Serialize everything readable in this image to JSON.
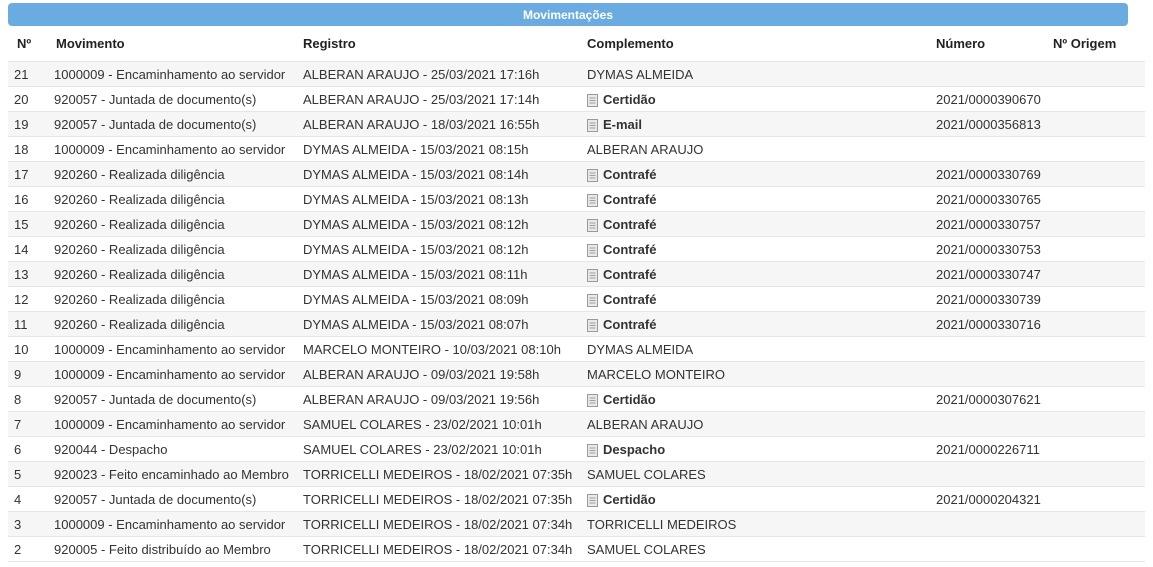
{
  "header": {
    "title": "Movimentações"
  },
  "columns": [
    "Nº",
    "Movimento",
    "Registro",
    "Complemento",
    "Número",
    "Nº Origem"
  ],
  "rows": [
    {
      "n": "21",
      "movimento": "1000009 - Encaminhamento ao servidor",
      "registro": "ALBERAN ARAUJO - 25/03/2021 17:16h",
      "complemento": "DYMAS ALMEIDA",
      "doc": false,
      "numero": "",
      "origem": ""
    },
    {
      "n": "20",
      "movimento": "920057 - Juntada de documento(s)",
      "registro": "ALBERAN ARAUJO - 25/03/2021 17:14h",
      "complemento": "Certidão",
      "doc": true,
      "numero": "2021/0000390670",
      "origem": ""
    },
    {
      "n": "19",
      "movimento": "920057 - Juntada de documento(s)",
      "registro": "ALBERAN ARAUJO - 18/03/2021 16:55h",
      "complemento": "E-mail",
      "doc": true,
      "numero": "2021/0000356813",
      "origem": ""
    },
    {
      "n": "18",
      "movimento": "1000009 - Encaminhamento ao servidor",
      "registro": "DYMAS ALMEIDA - 15/03/2021 08:15h",
      "complemento": "ALBERAN ARAUJO",
      "doc": false,
      "numero": "",
      "origem": ""
    },
    {
      "n": "17",
      "movimento": "920260 - Realizada diligência",
      "registro": "DYMAS ALMEIDA - 15/03/2021 08:14h",
      "complemento": "Contrafé",
      "doc": true,
      "numero": "2021/0000330769",
      "origem": ""
    },
    {
      "n": "16",
      "movimento": "920260 - Realizada diligência",
      "registro": "DYMAS ALMEIDA - 15/03/2021 08:13h",
      "complemento": "Contrafé",
      "doc": true,
      "numero": "2021/0000330765",
      "origem": ""
    },
    {
      "n": "15",
      "movimento": "920260 - Realizada diligência",
      "registro": "DYMAS ALMEIDA - 15/03/2021 08:12h",
      "complemento": "Contrafé",
      "doc": true,
      "numero": "2021/0000330757",
      "origem": ""
    },
    {
      "n": "14",
      "movimento": "920260 - Realizada diligência",
      "registro": "DYMAS ALMEIDA - 15/03/2021 08:12h",
      "complemento": "Contrafé",
      "doc": true,
      "numero": "2021/0000330753",
      "origem": ""
    },
    {
      "n": "13",
      "movimento": "920260 - Realizada diligência",
      "registro": "DYMAS ALMEIDA - 15/03/2021 08:11h",
      "complemento": "Contrafé",
      "doc": true,
      "numero": "2021/0000330747",
      "origem": ""
    },
    {
      "n": "12",
      "movimento": "920260 - Realizada diligência",
      "registro": "DYMAS ALMEIDA - 15/03/2021 08:09h",
      "complemento": "Contrafé",
      "doc": true,
      "numero": "2021/0000330739",
      "origem": ""
    },
    {
      "n": "11",
      "movimento": "920260 - Realizada diligência",
      "registro": "DYMAS ALMEIDA - 15/03/2021 08:07h",
      "complemento": "Contrafé",
      "doc": true,
      "numero": "2021/0000330716",
      "origem": ""
    },
    {
      "n": "10",
      "movimento": "1000009 - Encaminhamento ao servidor",
      "registro": "MARCELO MONTEIRO - 10/03/2021 08:10h",
      "complemento": "DYMAS ALMEIDA",
      "doc": false,
      "numero": "",
      "origem": ""
    },
    {
      "n": "9",
      "movimento": "1000009 - Encaminhamento ao servidor",
      "registro": "ALBERAN ARAUJO - 09/03/2021 19:58h",
      "complemento": "MARCELO MONTEIRO",
      "doc": false,
      "numero": "",
      "origem": ""
    },
    {
      "n": "8",
      "movimento": "920057 - Juntada de documento(s)",
      "registro": "ALBERAN ARAUJO - 09/03/2021 19:56h",
      "complemento": "Certidão",
      "doc": true,
      "numero": "2021/0000307621",
      "origem": ""
    },
    {
      "n": "7",
      "movimento": "1000009 - Encaminhamento ao servidor",
      "registro": "SAMUEL COLARES - 23/02/2021 10:01h",
      "complemento": "ALBERAN ARAUJO",
      "doc": false,
      "numero": "",
      "origem": ""
    },
    {
      "n": "6",
      "movimento": "920044 - Despacho",
      "registro": "SAMUEL COLARES - 23/02/2021 10:01h",
      "complemento": "Despacho",
      "doc": true,
      "numero": "2021/0000226711",
      "origem": ""
    },
    {
      "n": "5",
      "movimento": "920023 - Feito encaminhado ao Membro",
      "registro": "TORRICELLI MEDEIROS - 18/02/2021 07:35h",
      "complemento": "SAMUEL COLARES",
      "doc": false,
      "numero": "",
      "origem": ""
    },
    {
      "n": "4",
      "movimento": "920057 - Juntada de documento(s)",
      "registro": "TORRICELLI MEDEIROS - 18/02/2021 07:35h",
      "complemento": "Certidão",
      "doc": true,
      "numero": "2021/0000204321",
      "origem": ""
    },
    {
      "n": "3",
      "movimento": "1000009 - Encaminhamento ao servidor",
      "registro": "TORRICELLI MEDEIROS - 18/02/2021 07:34h",
      "complemento": "TORRICELLI MEDEIROS",
      "doc": false,
      "numero": "",
      "origem": ""
    },
    {
      "n": "2",
      "movimento": "920005 - Feito distribuído ao Membro",
      "registro": "TORRICELLI MEDEIROS - 18/02/2021 07:34h",
      "complemento": "SAMUEL COLARES",
      "doc": false,
      "numero": "",
      "origem": ""
    }
  ]
}
